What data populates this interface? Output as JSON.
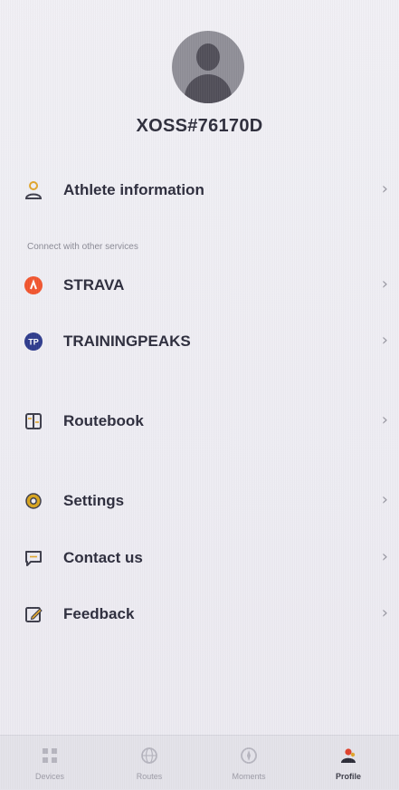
{
  "profile": {
    "username": "XOSS#76170D"
  },
  "menu": {
    "athlete_information": "Athlete information",
    "section_connect": "Connect with other services",
    "strava": "STRAVA",
    "trainingpeaks": "TRAININGPEAKS",
    "trainingpeaks_badge": "TP",
    "routebook": "Routebook",
    "settings": "Settings",
    "contact_us": "Contact us",
    "feedback": "Feedback",
    "chevron": "›"
  },
  "tabbar": {
    "tabs": [
      {
        "label": "Devices",
        "icon": "grid-icon"
      },
      {
        "label": "Routes",
        "icon": "globe-icon"
      },
      {
        "label": "Moments",
        "icon": "compass-icon"
      },
      {
        "label": "Profile",
        "icon": "profile-icon"
      }
    ],
    "active_index": 3
  },
  "colors": {
    "strava": "#f2542d",
    "trainingpeaks": "#2d3a8c",
    "settings": "#d9a51c",
    "feedback": "#e0a52a",
    "icon_dark": "#3c3c4a"
  }
}
